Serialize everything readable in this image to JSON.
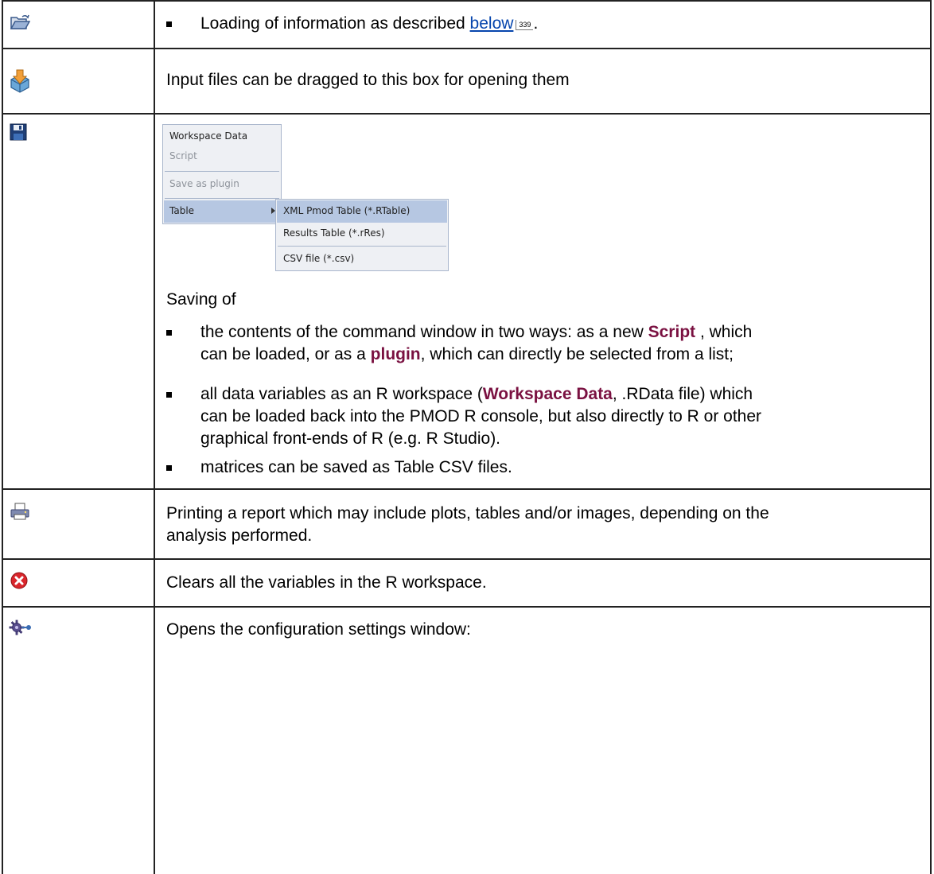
{
  "rows": [
    {
      "icon": "open-folder-icon",
      "bullets": [
        {
          "text_before": "Loading of information as described ",
          "link": "below",
          "ref": "339",
          "text_after": "."
        }
      ]
    },
    {
      "icon": "drop-box-icon",
      "text": "Input files can be dragged to this box for opening them"
    },
    {
      "icon": "save-disk-icon",
      "menu": {
        "items": [
          "Workspace Data",
          "Script",
          "Save as plugin",
          "Table"
        ],
        "submenu": [
          "XML Pmod Table (*.RTable)",
          "Results Table (*.rRes)",
          "CSV file (*.csv)"
        ]
      },
      "intro": "Saving of",
      "bullets": [
        {
          "a": "the contents of the command window in two ways: as a new ",
          "b": "Script",
          "c": " , which",
          "d": "can be loaded, or as a ",
          "e": "plugin",
          "f": ", which can directly be selected from a list;"
        },
        {
          "a": "all data variables as an R workspace (",
          "b": "Workspace Data",
          "c": ", .RData file) which",
          "d": "can be loaded back into the PMOD R console, but also directly to R or other",
          "e": "graphical front-ends of R (e.g. R Studio)."
        },
        {
          "a": "matrices can be saved as Table CSV files."
        }
      ]
    },
    {
      "icon": "printer-icon",
      "line1": "Printing a report which may include plots, tables and/or images, depending on the",
      "line2": "analysis performed."
    },
    {
      "icon": "clear-red-x-icon",
      "text": "Clears all the variables in the R workspace."
    },
    {
      "icon": "settings-gear-icon",
      "text": "Opens the configuration settings window:"
    }
  ],
  "colors": {
    "emphasis": "#7a1141",
    "link": "#0645ad",
    "border": "#222222"
  }
}
